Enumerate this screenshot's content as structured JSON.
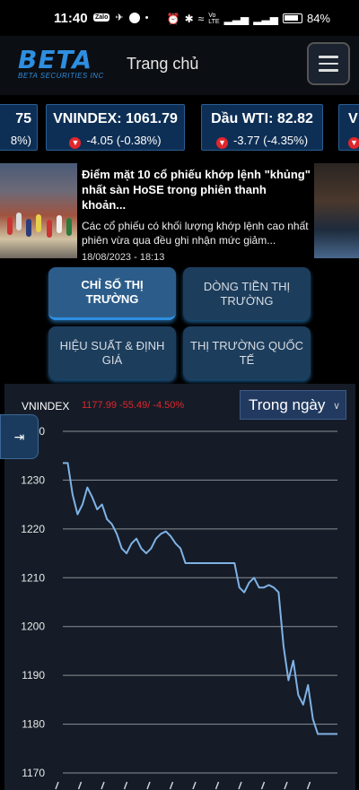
{
  "status_bar": {
    "time": "11:40",
    "battery": "84%",
    "icons": [
      "zalo-icon",
      "telegram-icon",
      "messenger-icon",
      "dot-icon",
      "alarm-icon",
      "bluetooth-icon",
      "wifi-icon",
      "volte-icon",
      "signal-icon",
      "signal-icon",
      "battery-icon"
    ]
  },
  "header": {
    "logo_word": "BETA",
    "logo_sub": "BETA SECURITIES INC",
    "title": "Trang chủ"
  },
  "ticker": [
    {
      "name": "75",
      "change": "8%)"
    },
    {
      "name": "VNINDEX: 1061.79",
      "change": "-4.05 (-0.38%)"
    },
    {
      "name": "Dầu WTI: 82.82",
      "change": "-3.77 (-4.35%)"
    },
    {
      "name": "V",
      "change": ""
    }
  ],
  "news": {
    "headline": "Điểm mặt 10 cổ phiếu khớp lệnh \"khủng\" nhất sàn HoSE trong phiên thanh khoản...",
    "summary": "Các cổ phiếu có khối lượng khớp lệnh cao nhất phiên vừa qua đều ghi nhận mức giảm...",
    "date": "18/08/2023 - 18:13"
  },
  "menu": [
    {
      "label": "CHỈ SỐ THỊ TRƯỜNG",
      "active": true
    },
    {
      "label": "DÒNG TIỀN THỊ TRƯỜNG",
      "active": false
    },
    {
      "label": "HIỆU SUẤT & ĐỊNH GIÁ",
      "active": false
    },
    {
      "label": "THỊ TRƯỜNG QUỐC TẾ",
      "active": false
    }
  ],
  "chart_header": {
    "index_name": "VNINDEX",
    "value_text": "1177.99  -55.49/ -4.50%",
    "period": "Trong ngày",
    "side_button_icon": "expand-arrow-icon"
  },
  "colors": {
    "line": "#7fb2e6",
    "down": "#e0262c",
    "accent": "#2d8fe1",
    "panel": "#151c27"
  },
  "chart_data": {
    "type": "line",
    "title": "",
    "xlabel": "",
    "ylabel": "",
    "ylim": [
      1170,
      1240
    ],
    "yticks": [
      1170,
      1180,
      1190,
      1200,
      1210,
      1220,
      1230,
      1240
    ],
    "grid": true,
    "legend": "none",
    "x": [
      0,
      1,
      2,
      3,
      4,
      5,
      6,
      7,
      8,
      9,
      10,
      11,
      12,
      13,
      14,
      15,
      16,
      17,
      18,
      19,
      20,
      21,
      22,
      23,
      24,
      25,
      26,
      27,
      28,
      29,
      30,
      31,
      32,
      33,
      34,
      35,
      36,
      37,
      38,
      39,
      40,
      41,
      42,
      43,
      44,
      45,
      46,
      47,
      48,
      49,
      50,
      51,
      52,
      53,
      54,
      55,
      56
    ],
    "series": [
      {
        "name": "",
        "values": [
          1233.5,
          1233.5,
          1227,
          1223,
          1225,
          1228.5,
          1226.5,
          1224,
          1225,
          1222,
          1221,
          1219,
          1216,
          1215,
          1217,
          1218,
          1216,
          1215,
          1216,
          1218,
          1219,
          1219.5,
          1218.5,
          1217,
          1216,
          1213,
          1213,
          1213,
          1213,
          1213,
          1213,
          1213,
          1213,
          1213,
          1213,
          1213,
          1208,
          1207,
          1209,
          1210,
          1208,
          1208,
          1208.5,
          1208,
          1207,
          1196,
          1189,
          1193,
          1186,
          1184,
          1188,
          1181,
          1178,
          1178,
          1178,
          1178,
          1178
        ]
      }
    ]
  }
}
